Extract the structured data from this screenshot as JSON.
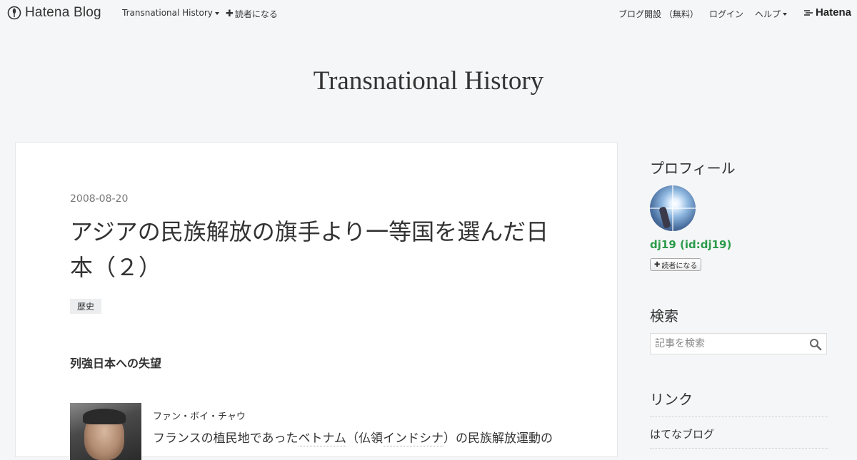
{
  "header": {
    "logo_text": "Hatena Blog",
    "blog_menu": "Transnational History",
    "follow": "読者になる",
    "open_blog": "ブログ開設 （無料）",
    "login": "ログイン",
    "help": "ヘルプ",
    "hatena": "Hatena"
  },
  "blog": {
    "title": "Transnational History"
  },
  "entry": {
    "date": "2008-08-20",
    "title": "アジアの民族解放の旗手より一等国を選んだ日本（２）",
    "category": "歴史",
    "section_heading": "列強日本への失望",
    "caption": "ファン・ボイ・チャウ",
    "body_pre": "フランスの植民地であった",
    "body_kw1": "ベトナム",
    "body_mid": "（仏領",
    "body_kw2": "インドシナ",
    "body_post": "）の民族解放運動の"
  },
  "sidebar": {
    "profile_heading": "プロフィール",
    "profile_name": "dj19 (id:dj19)",
    "follow_button": "読者になる",
    "search_heading": "検索",
    "search_placeholder": "記事を検索",
    "links_heading": "リンク",
    "link_1": "はてなブログ"
  },
  "icons": {
    "logo": "hatena-blog-logo-icon",
    "search": "search-icon",
    "plus": "plus-icon",
    "caret": "caret-down-icon"
  },
  "colors": {
    "profile_name": "#2a9b4a",
    "background": "#f5f6f7"
  }
}
